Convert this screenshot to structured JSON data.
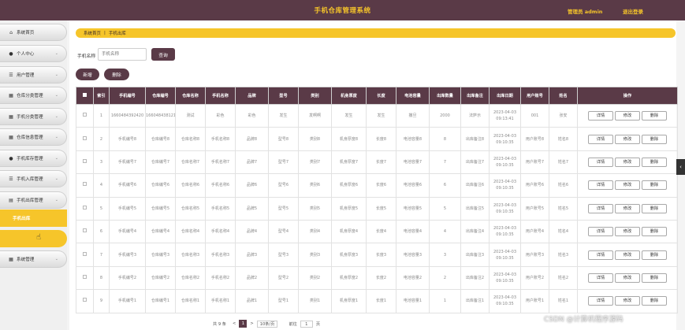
{
  "header": {
    "title": "手机仓库管理系统",
    "admin": "管理员 admin",
    "logout": "退出登录"
  },
  "sidebar": {
    "items": [
      {
        "label": "系统首页",
        "icon": "⌂"
      },
      {
        "label": "个人中心",
        "icon": "●"
      },
      {
        "label": "用户管理",
        "icon": "☰"
      },
      {
        "label": "仓库分类管理",
        "icon": "▦"
      },
      {
        "label": "手机分类管理",
        "icon": "▦"
      },
      {
        "label": "仓库信息管理",
        "icon": "▦"
      },
      {
        "label": "手机库存管理",
        "icon": "●"
      },
      {
        "label": "手机入库管理",
        "icon": "☰"
      },
      {
        "label": "手机出库管理",
        "icon": "▤"
      },
      {
        "label": "系统管理",
        "icon": "▦"
      }
    ],
    "active_sub": "手机出库",
    "hover_sub": "",
    "chevron": "⌄"
  },
  "breadcrumb": {
    "home": "系统首页",
    "sep": "|",
    "current": "手机出库"
  },
  "search": {
    "label": "手机名称",
    "placeholder": "手机名称",
    "button": "查询"
  },
  "actions": {
    "add": "新增",
    "delete": "删除"
  },
  "table": {
    "columns": [
      "索引",
      "手机编号",
      "仓库编号",
      "仓库名称",
      "手机名称",
      "品牌",
      "型号",
      "类别",
      "机身厚度",
      "长度",
      "电池容量",
      "出库数量",
      "出库备注",
      "出库日期",
      "用户账号",
      "姓名",
      "操作"
    ],
    "row_buttons": [
      "详情",
      "修改",
      "删除"
    ],
    "rows": [
      [
        "1",
        "1660484392420",
        "1660484381219",
        "测试",
        "彩色",
        "彩色",
        "发生",
        "发啊啊",
        "发生",
        "发生",
        "撒旦",
        "2000",
        "法萨示",
        "2023-04-03 09:13:41",
        "001",
        "张安"
      ],
      [
        "2",
        "手机编号8",
        "仓库编号8",
        "仓库名称8",
        "手机名称8",
        "品牌8",
        "型号8",
        "类别8",
        "机身厚度8",
        "长度8",
        "电池容量8",
        "8",
        "出库备注8",
        "2023-04-03 09:10:35",
        "用户账号8",
        "姓名8"
      ],
      [
        "3",
        "手机编号7",
        "仓库编号7",
        "仓库名称7",
        "手机名称7",
        "品牌7",
        "型号7",
        "类别7",
        "机身厚度7",
        "长度7",
        "电池容量7",
        "7",
        "出库备注7",
        "2023-04-03 09:10:35",
        "用户账号7",
        "姓名7"
      ],
      [
        "4",
        "手机编号6",
        "仓库编号6",
        "仓库名称6",
        "手机名称6",
        "品牌6",
        "型号6",
        "类别6",
        "机身厚度6",
        "长度6",
        "电池容量6",
        "6",
        "出库备注6",
        "2023-04-03 09:10:35",
        "用户账号6",
        "姓名6"
      ],
      [
        "5",
        "手机编号5",
        "仓库编号5",
        "仓库名称5",
        "手机名称5",
        "品牌5",
        "型号5",
        "类别5",
        "机身厚度5",
        "长度5",
        "电池容量5",
        "5",
        "出库备注5",
        "2023-04-03 09:10:35",
        "用户账号5",
        "姓名5"
      ],
      [
        "6",
        "手机编号4",
        "仓库编号4",
        "仓库名称4",
        "手机名称4",
        "品牌4",
        "型号4",
        "类别4",
        "机身厚度4",
        "长度4",
        "电池容量4",
        "4",
        "出库备注4",
        "2023-04-03 09:10:35",
        "用户账号4",
        "姓名4"
      ],
      [
        "7",
        "手机编号3",
        "仓库编号3",
        "仓库名称3",
        "手机名称3",
        "品牌3",
        "型号3",
        "类别3",
        "机身厚度3",
        "长度3",
        "电池容量3",
        "3",
        "出库备注3",
        "2023-04-03 09:10:35",
        "用户账号3",
        "姓名3"
      ],
      [
        "8",
        "手机编号2",
        "仓库编号2",
        "仓库名称2",
        "手机名称2",
        "品牌2",
        "型号2",
        "类别2",
        "机身厚度2",
        "长度2",
        "电池容量2",
        "2",
        "出库备注2",
        "2023-04-03 09:10:35",
        "用户账号2",
        "姓名2"
      ],
      [
        "9",
        "手机编号1",
        "仓库编号1",
        "仓库名称1",
        "手机名称1",
        "品牌1",
        "型号1",
        "类别1",
        "机身厚度1",
        "长度1",
        "电池容量1",
        "1",
        "出库备注1",
        "2023-04-03 09:10:35",
        "用户账号1",
        "姓名1"
      ]
    ]
  },
  "pager": {
    "total": "共 9 条",
    "prev": "<",
    "page": "1",
    "next": ">",
    "per_page": "10条/页",
    "goto_label": "前往",
    "goto_value": "1",
    "goto_unit": "页"
  },
  "watermark": "CSDN @计算机程序源码",
  "colors": {
    "primary": "#5a3a47",
    "accent": "#f6c52a"
  }
}
